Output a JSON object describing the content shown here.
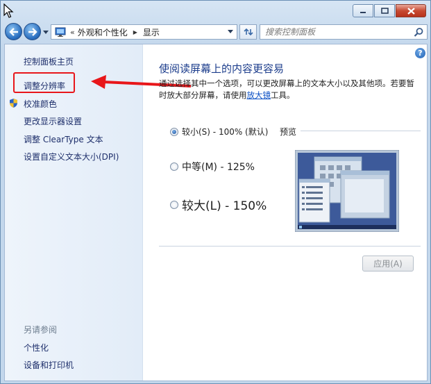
{
  "nav": {
    "breadcrumb_overflow": "«",
    "breadcrumb": [
      "外观和个性化",
      "显示"
    ],
    "search_placeholder": "搜索控制面板"
  },
  "sidebar": {
    "items": [
      "控制面板主页",
      "调整分辨率",
      "校准颜色",
      "更改显示器设置",
      "调整 ClearType 文本",
      "设置自定义文本大小(DPI)"
    ],
    "see_also_heading": "另请参阅",
    "see_also_items": [
      "个性化",
      "设备和打印机"
    ]
  },
  "main": {
    "help": "?",
    "title": "使阅读屏幕上的内容更容易",
    "desc_part1": "通过选择其中一个选项，可以更改屏幕上的文本大小以及其他项。若要暂时放大部分屏幕，请使用",
    "desc_link": "放大镜",
    "desc_part2": "工具。",
    "options": [
      {
        "label": "较小(S) - 100% (默认)",
        "selected": true
      },
      {
        "label": "中等(M) - 125%",
        "selected": false
      },
      {
        "label": "较大(L) - 150%",
        "selected": false
      }
    ],
    "preview_label": "预览",
    "apply_label": "应用(A)"
  },
  "colors": {
    "highlight": "#e8161a",
    "link": "#1e2f6b",
    "title": "#1c3d8c"
  }
}
